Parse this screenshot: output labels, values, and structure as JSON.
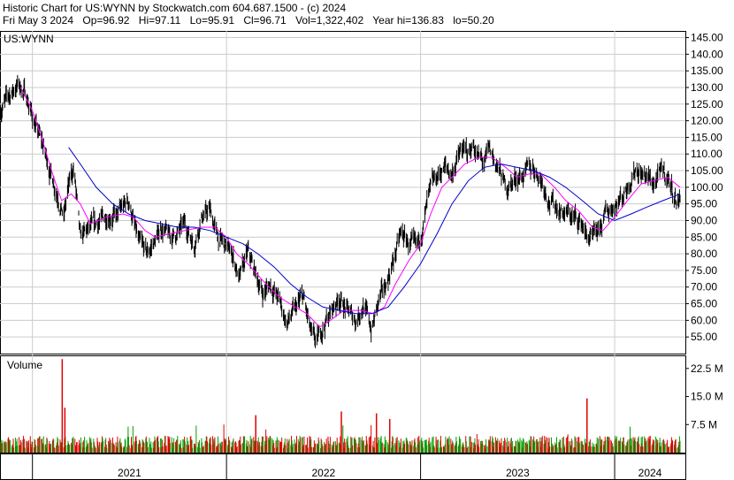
{
  "header": {
    "title": "Historic Chart for US:WYNN by Stockwatch.com 604.687.1500 - (c) 2024",
    "date": "Fri May  3 2024",
    "open": "Op=96.92",
    "high": "Hi=97.11",
    "low": "Lo=95.91",
    "close": "Cl=96.71",
    "volume": "Vol=1,322,402",
    "year_high": "Year hi=136.83",
    "year_low": "lo=50.20"
  },
  "colors": {
    "price": "#000000",
    "ma_short": "#ff00ff",
    "ma_long": "#0000cc",
    "volume_up": "#00a000",
    "volume_down": "#e00000",
    "grid": "#cccccc"
  },
  "chart_data": [
    {
      "type": "line",
      "panel": "price",
      "symbol_label": "US:WYNN",
      "ylim": [
        50,
        147
      ],
      "y_ticks": [
        "145.00",
        "140.00",
        "135.00",
        "130.00",
        "125.00",
        "120.00",
        "115.00",
        "110.00",
        "105.00",
        "100.00",
        "95.00",
        "90.00",
        "85.00",
        "80.00",
        "75.00",
        "70.00",
        "65.00",
        "60.00",
        "55.00"
      ],
      "x_ticks": [
        "2021",
        "2022",
        "2023",
        "2024"
      ],
      "x_range": [
        "2020-11-01",
        "2024-05-03"
      ],
      "series": [
        {
          "role": "close",
          "values": [
            [
              "2020-11-01",
              123
            ],
            [
              "2020-11-20",
              128
            ],
            [
              "2020-12-05",
              131
            ],
            [
              "2020-12-20",
              128
            ],
            [
              "2021-01-05",
              119
            ],
            [
              "2021-01-20",
              113
            ],
            [
              "2021-02-05",
              104
            ],
            [
              "2021-02-20",
              97
            ],
            [
              "2021-03-01",
              91
            ],
            [
              "2021-03-10",
              100
            ],
            [
              "2021-03-20",
              106
            ],
            [
              "2021-04-01",
              84
            ],
            [
              "2021-04-10",
              86
            ],
            [
              "2021-04-25",
              88
            ],
            [
              "2021-05-10",
              90
            ],
            [
              "2021-05-25",
              92
            ],
            [
              "2021-06-10",
              91
            ],
            [
              "2021-06-20",
              94
            ],
            [
              "2021-07-01",
              96
            ],
            [
              "2021-07-20",
              83
            ],
            [
              "2021-08-05",
              80
            ],
            [
              "2021-08-20",
              84
            ],
            [
              "2021-09-01",
              88
            ],
            [
              "2021-09-15",
              85
            ],
            [
              "2021-10-01",
              86
            ],
            [
              "2021-10-15",
              89
            ],
            [
              "2021-11-01",
              83
            ],
            [
              "2021-11-15",
              91
            ],
            [
              "2021-12-01",
              93
            ],
            [
              "2021-12-15",
              85
            ],
            [
              "2022-01-01",
              82
            ],
            [
              "2022-01-15",
              79
            ],
            [
              "2022-01-25",
              72
            ],
            [
              "2022-02-10",
              80
            ],
            [
              "2022-02-25",
              74
            ],
            [
              "2022-03-10",
              68
            ],
            [
              "2022-03-25",
              71
            ],
            [
              "2022-04-10",
              66
            ],
            [
              "2022-04-25",
              59
            ],
            [
              "2022-05-10",
              63
            ],
            [
              "2022-05-25",
              67
            ],
            [
              "2022-06-10",
              55
            ],
            [
              "2022-06-20",
              53
            ],
            [
              "2022-07-01",
              58
            ],
            [
              "2022-07-15",
              62
            ],
            [
              "2022-08-01",
              67
            ],
            [
              "2022-08-15",
              63
            ],
            [
              "2022-09-01",
              60
            ],
            [
              "2022-09-15",
              65
            ],
            [
              "2022-10-01",
              57
            ],
            [
              "2022-10-15",
              66
            ],
            [
              "2022-10-25",
              69
            ],
            [
              "2022-11-05",
              75
            ],
            [
              "2022-11-15",
              80
            ],
            [
              "2022-11-25",
              86
            ],
            [
              "2022-12-10",
              83
            ],
            [
              "2022-12-25",
              81
            ],
            [
              "2023-01-05",
              88
            ],
            [
              "2023-01-15",
              96
            ],
            [
              "2023-01-25",
              101
            ],
            [
              "2023-02-05",
              104
            ],
            [
              "2023-02-15",
              106
            ],
            [
              "2023-03-01",
              104
            ],
            [
              "2023-03-10",
              108
            ],
            [
              "2023-03-20",
              111
            ],
            [
              "2023-04-01",
              110
            ],
            [
              "2023-04-10",
              113
            ],
            [
              "2023-04-20",
              109
            ],
            [
              "2023-05-01",
              107
            ],
            [
              "2023-05-10",
              111
            ],
            [
              "2023-05-20",
              108
            ],
            [
              "2023-06-01",
              104
            ],
            [
              "2023-06-10",
              100
            ],
            [
              "2023-06-20",
              101
            ],
            [
              "2023-07-01",
              103
            ],
            [
              "2023-07-15",
              104
            ],
            [
              "2023-08-01",
              106
            ],
            [
              "2023-08-10",
              104
            ],
            [
              "2023-08-20",
              101
            ],
            [
              "2023-09-01",
              96
            ],
            [
              "2023-09-15",
              94
            ],
            [
              "2023-10-01",
              92
            ],
            [
              "2023-10-15",
              91
            ],
            [
              "2023-11-01",
              89
            ],
            [
              "2023-11-10",
              85
            ],
            [
              "2023-11-20",
              84
            ],
            [
              "2023-12-01",
              86
            ],
            [
              "2023-12-15",
              92
            ],
            [
              "2024-01-01",
              95
            ],
            [
              "2024-01-15",
              97
            ],
            [
              "2024-02-01",
              103
            ],
            [
              "2024-02-10",
              106
            ],
            [
              "2024-02-20",
              104
            ],
            [
              "2024-03-01",
              103
            ],
            [
              "2024-03-15",
              101
            ],
            [
              "2024-04-01",
              105
            ],
            [
              "2024-04-10",
              103
            ],
            [
              "2024-04-20",
              99
            ],
            [
              "2024-04-28",
              95
            ],
            [
              "2024-05-03",
              96.71
            ]
          ]
        },
        {
          "role": "ma_short",
          "values": [
            [
              "2020-12-10",
              130
            ],
            [
              "2021-01-01",
              123
            ],
            [
              "2021-01-20",
              114
            ],
            [
              "2021-02-10",
              103
            ],
            [
              "2021-02-25",
              96
            ],
            [
              "2021-03-15",
              98
            ],
            [
              "2021-04-01",
              95
            ],
            [
              "2021-04-20",
              89
            ],
            [
              "2021-05-20",
              91
            ],
            [
              "2021-06-20",
              92
            ],
            [
              "2021-07-10",
              91
            ],
            [
              "2021-08-01",
              87
            ],
            [
              "2021-08-20",
              85
            ],
            [
              "2021-09-15",
              86
            ],
            [
              "2021-10-15",
              87
            ],
            [
              "2021-11-15",
              88
            ],
            [
              "2021-12-10",
              88
            ],
            [
              "2022-01-01",
              85
            ],
            [
              "2022-01-20",
              80
            ],
            [
              "2022-02-10",
              77
            ],
            [
              "2022-03-10",
              72
            ],
            [
              "2022-04-10",
              67
            ],
            [
              "2022-05-10",
              64
            ],
            [
              "2022-06-01",
              62
            ],
            [
              "2022-06-25",
              58
            ],
            [
              "2022-07-15",
              60
            ],
            [
              "2022-08-10",
              63
            ],
            [
              "2022-09-10",
              63
            ],
            [
              "2022-10-05",
              62
            ],
            [
              "2022-10-25",
              64
            ],
            [
              "2022-11-15",
              71
            ],
            [
              "2022-12-10",
              78
            ],
            [
              "2023-01-01",
              83
            ],
            [
              "2023-01-20",
              92
            ],
            [
              "2023-02-10",
              100
            ],
            [
              "2023-03-01",
              103
            ],
            [
              "2023-03-25",
              107
            ],
            [
              "2023-04-20",
              109
            ],
            [
              "2023-05-15",
              109
            ],
            [
              "2023-06-10",
              106
            ],
            [
              "2023-07-01",
              103
            ],
            [
              "2023-07-25",
              104
            ],
            [
              "2023-08-15",
              104
            ],
            [
              "2023-09-10",
              100
            ],
            [
              "2023-10-01",
              96
            ],
            [
              "2023-10-25",
              93
            ],
            [
              "2023-11-20",
              88
            ],
            [
              "2023-12-10",
              87
            ],
            [
              "2024-01-01",
              91
            ],
            [
              "2024-01-25",
              96
            ],
            [
              "2024-02-20",
              101
            ],
            [
              "2024-03-15",
              102
            ],
            [
              "2024-04-10",
              103
            ],
            [
              "2024-05-03",
              100
            ]
          ]
        },
        {
          "role": "ma_long",
          "values": [
            [
              "2021-03-10",
              112
            ],
            [
              "2021-04-01",
              107
            ],
            [
              "2021-05-01",
              100
            ],
            [
              "2021-06-01",
              95
            ],
            [
              "2021-07-01",
              92
            ],
            [
              "2021-08-01",
              90
            ],
            [
              "2021-09-01",
              89
            ],
            [
              "2021-10-01",
              88
            ],
            [
              "2021-11-01",
              88
            ],
            [
              "2021-12-01",
              87
            ],
            [
              "2022-01-01",
              85
            ],
            [
              "2022-02-01",
              83
            ],
            [
              "2022-03-01",
              80
            ],
            [
              "2022-04-01",
              76
            ],
            [
              "2022-05-01",
              71
            ],
            [
              "2022-06-01",
              67
            ],
            [
              "2022-07-01",
              64
            ],
            [
              "2022-08-01",
              63
            ],
            [
              "2022-09-01",
              62
            ],
            [
              "2022-10-01",
              62
            ],
            [
              "2022-11-01",
              64
            ],
            [
              "2022-12-01",
              70
            ],
            [
              "2023-01-01",
              77
            ],
            [
              "2023-02-01",
              86
            ],
            [
              "2023-03-01",
              95
            ],
            [
              "2023-04-01",
              102
            ],
            [
              "2023-05-01",
              106
            ],
            [
              "2023-06-01",
              107
            ],
            [
              "2023-07-01",
              106
            ],
            [
              "2023-08-01",
              105
            ],
            [
              "2023-09-01",
              103
            ],
            [
              "2023-10-01",
              100
            ],
            [
              "2023-11-01",
              96
            ],
            [
              "2023-12-01",
              92
            ],
            [
              "2024-01-01",
              90
            ],
            [
              "2024-02-01",
              92
            ],
            [
              "2024-03-01",
              94
            ],
            [
              "2024-04-01",
              96
            ],
            [
              "2024-05-03",
              98
            ]
          ]
        }
      ]
    },
    {
      "type": "bar",
      "panel": "volume",
      "title": "Volume",
      "ylim": [
        0,
        26000000
      ],
      "y_ticks": [
        {
          "value": 22500000,
          "label": "22.5 M"
        },
        {
          "value": 15000000,
          "label": "15.0 M"
        },
        {
          "value": 7500000,
          "label": "7.5 M"
        }
      ],
      "typical_volume": 3000000,
      "spikes": [
        {
          "date": "2021-02-26",
          "value": 25000000
        },
        {
          "date": "2021-03-03",
          "value": 12000000
        },
        {
          "date": "2022-02-25",
          "value": 10000000
        },
        {
          "date": "2022-08-05",
          "value": 11000000
        },
        {
          "date": "2022-10-10",
          "value": 10500000
        },
        {
          "date": "2023-11-10",
          "value": 14500000
        },
        {
          "date": "2022-11-04",
          "value": 9000000
        }
      ]
    }
  ]
}
